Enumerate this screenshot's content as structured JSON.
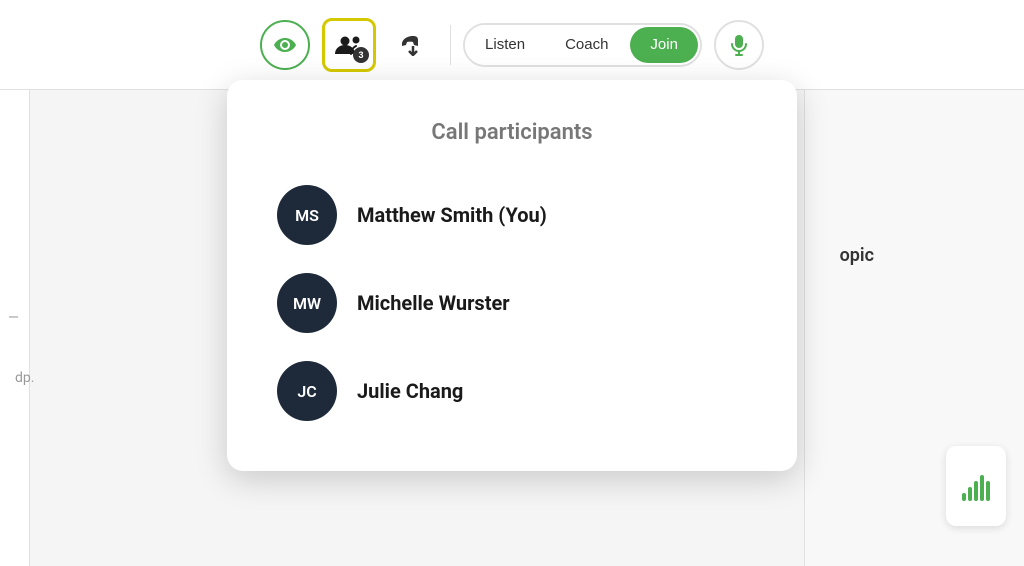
{
  "toolbar": {
    "eye_label": "Eye",
    "participants_label": "Participants",
    "participants_count": "3",
    "hangup_label": "Hang Up",
    "listen_label": "Listen",
    "coach_label": "Coach",
    "join_label": "Join",
    "mic_label": "Microphone"
  },
  "popup": {
    "title": "Call participants",
    "participants": [
      {
        "initials": "MS",
        "name": "Matthew Smith (You)"
      },
      {
        "initials": "MW",
        "name": "Michelle Wurster"
      },
      {
        "initials": "JC",
        "name": "Julie Chang"
      }
    ]
  },
  "background": {
    "topic_label": "opic",
    "sidebar_text_dp": "dp.",
    "sidebar_text_dash": "—"
  },
  "audio_bars": [
    8,
    14,
    20,
    26,
    20
  ],
  "colors": {
    "green": "#4CAF50",
    "dark_navy": "#1e2a3a",
    "yellow_border": "#d4c800"
  }
}
